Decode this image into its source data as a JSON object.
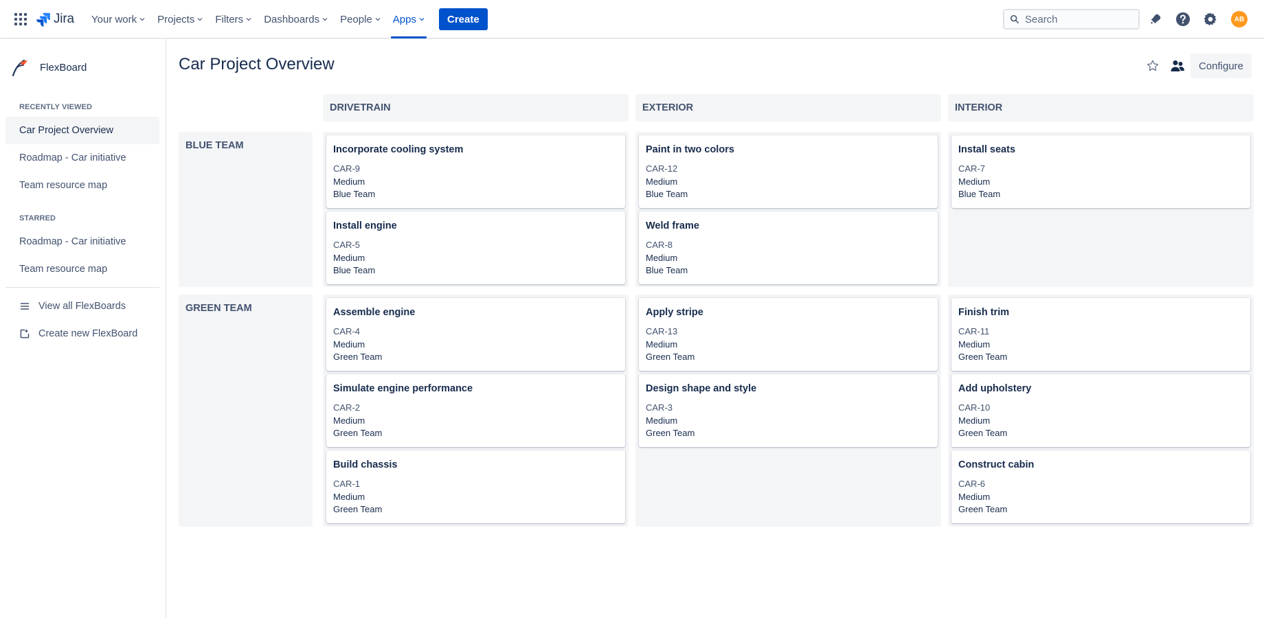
{
  "nav": {
    "logo": "Jira",
    "items": [
      {
        "label": "Your work",
        "active": false
      },
      {
        "label": "Projects",
        "active": false
      },
      {
        "label": "Filters",
        "active": false
      },
      {
        "label": "Dashboards",
        "active": false
      },
      {
        "label": "People",
        "active": false
      },
      {
        "label": "Apps",
        "active": true
      }
    ],
    "create_label": "Create",
    "search_placeholder": "Search",
    "avatar_initials": "AB"
  },
  "sidebar": {
    "app_name": "FlexBoard",
    "recent_heading": "RECENTLY VIEWED",
    "recent": [
      "Car Project Overview",
      "Roadmap - Car initiative",
      "Team resource map"
    ],
    "starred_heading": "STARRED",
    "starred": [
      "Roadmap - Car initiative",
      "Team resource map"
    ],
    "view_all": "View all FlexBoards",
    "create_new": "Create new FlexBoard"
  },
  "page": {
    "title": "Car Project Overview",
    "configure_label": "Configure"
  },
  "board": {
    "columns": [
      "DRIVETRAIN",
      "EXTERIOR",
      "INTERIOR"
    ],
    "rows": [
      {
        "name": "BLUE TEAM",
        "cells": [
          [
            {
              "title": "Incorporate cooling system",
              "key": "CAR-9",
              "priority": "Medium",
              "team": "Blue Team"
            },
            {
              "title": "Install engine",
              "key": "CAR-5",
              "priority": "Medium",
              "team": "Blue Team"
            }
          ],
          [
            {
              "title": "Paint in two colors",
              "key": "CAR-12",
              "priority": "Medium",
              "team": "Blue Team"
            },
            {
              "title": "Weld frame",
              "key": "CAR-8",
              "priority": "Medium",
              "team": "Blue Team"
            }
          ],
          [
            {
              "title": "Install seats",
              "key": "CAR-7",
              "priority": "Medium",
              "team": "Blue Team"
            }
          ]
        ]
      },
      {
        "name": "GREEN TEAM",
        "cells": [
          [
            {
              "title": "Assemble engine",
              "key": "CAR-4",
              "priority": "Medium",
              "team": "Green Team"
            },
            {
              "title": "Simulate engine performance",
              "key": "CAR-2",
              "priority": "Medium",
              "team": "Green Team"
            },
            {
              "title": "Build chassis",
              "key": "CAR-1",
              "priority": "Medium",
              "team": "Green Team"
            }
          ],
          [
            {
              "title": "Apply stripe",
              "key": "CAR-13",
              "priority": "Medium",
              "team": "Green Team"
            },
            {
              "title": "Design shape and style",
              "key": "CAR-3",
              "priority": "Medium",
              "team": "Green Team"
            }
          ],
          [
            {
              "title": "Finish trim",
              "key": "CAR-11",
              "priority": "Medium",
              "team": "Green Team"
            },
            {
              "title": "Add upholstery",
              "key": "CAR-10",
              "priority": "Medium",
              "team": "Green Team"
            },
            {
              "title": "Construct cabin",
              "key": "CAR-6",
              "priority": "Medium",
              "team": "Green Team"
            }
          ]
        ]
      }
    ]
  },
  "colors": {
    "accent": "#0052cc",
    "avatar": "#ff991f",
    "cell_bg": "#f4f5f7",
    "text": "#172b4d"
  }
}
